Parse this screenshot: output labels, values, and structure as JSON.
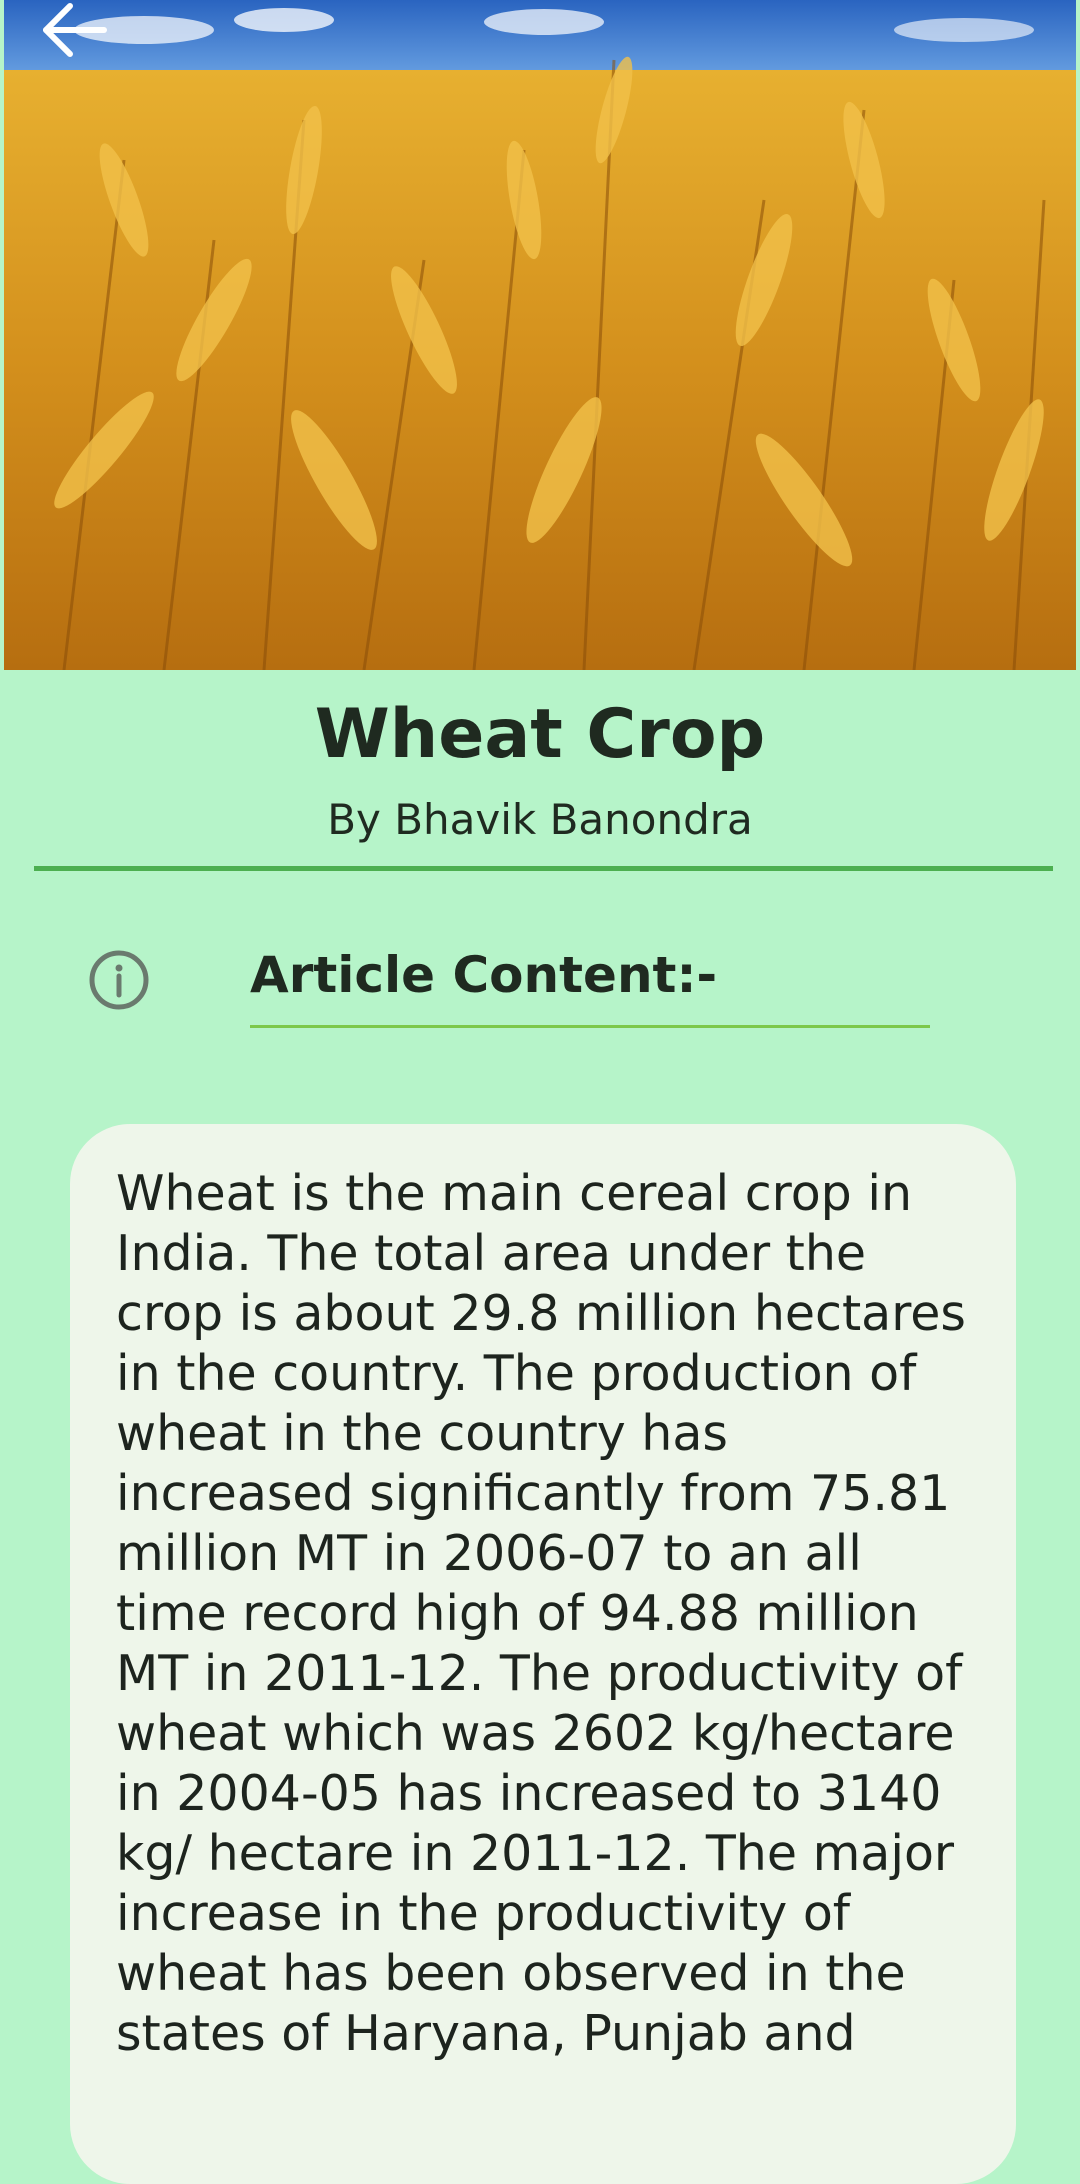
{
  "toolbar": {
    "back_icon": "arrow-left-icon"
  },
  "hero": {
    "image_subject": "wheat-field-photo"
  },
  "article": {
    "title": "Wheat Crop",
    "author": "By Bhavik Banondra",
    "section_icon": "info-icon",
    "section_label": "Article Content:-",
    "body": "Wheat is the main cereal crop in India. The total area under the crop is about 29.8 million hectares in the country. The production of wheat in the country has increased significantly from 75.81 million MT in 2006-07 to an all time record high of 94.88 million MT in 2011-12. The productivity of wheat which was 2602 kg/hectare in 2004-05 has increased to 3140 kg/ hectare in 2011-12. The major increase in the productivity of wheat has been observed in the states of Haryana, Punjab and"
  },
  "colors": {
    "background": "#b6f4c9",
    "accent_green": "#4caf50",
    "card_background": "#eef6ea",
    "text": "#1d241e"
  }
}
